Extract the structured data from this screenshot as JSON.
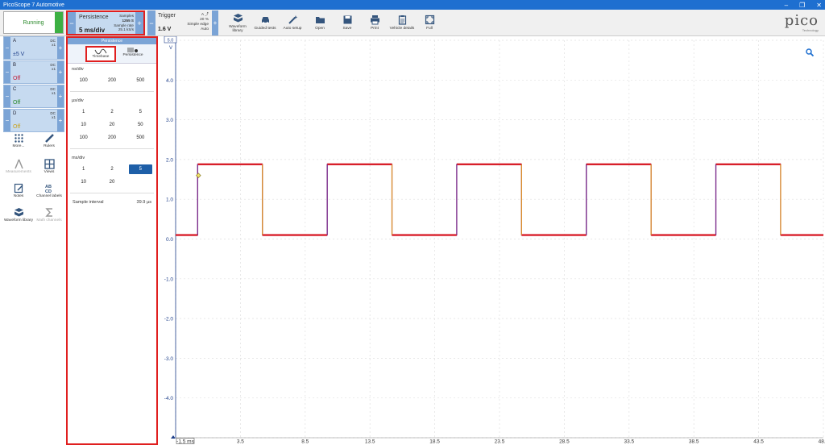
{
  "window": {
    "title": "PicoScope 7 Automotive",
    "controls": [
      "–",
      "❐",
      "✕"
    ]
  },
  "toolbar": {
    "run_label": "Running",
    "persistence": {
      "label": "Persistence",
      "timebase": "5 ms/div",
      "samples_label": "Samples",
      "samples": "1255 S",
      "sample_rate_label": "Sample rate",
      "sample_rate": "25.1 kS/s"
    },
    "trigger": {
      "label": "Trigger",
      "level": "1.6 V",
      "pct": "20 %",
      "mode": "Simple edge",
      "type": "Auto"
    },
    "tools": [
      {
        "label": "Waveform library",
        "icon": "library-icon"
      },
      {
        "label": "Guided tests",
        "icon": "car-icon"
      },
      {
        "label": "Auto setup",
        "icon": "wand-icon"
      },
      {
        "label": "Open",
        "icon": "folder-icon"
      },
      {
        "label": "Save",
        "icon": "save-icon"
      },
      {
        "label": "Print",
        "icon": "print-icon"
      },
      {
        "label": "Vehicle details",
        "icon": "clipboard-icon"
      },
      {
        "label": "Full",
        "icon": "fullscreen-icon"
      }
    ],
    "logo": "pico",
    "logo_sub": "Technology"
  },
  "channels": [
    {
      "name": "A",
      "coupling": "DC",
      "probe": "x1",
      "range": "±5 V",
      "color": "#1e3f8a"
    },
    {
      "name": "B",
      "coupling": "DC",
      "probe": "x1",
      "range": "Off",
      "color": "#c0203a"
    },
    {
      "name": "C",
      "coupling": "DC",
      "probe": "x1",
      "range": "Off",
      "color": "#2a8a2a"
    },
    {
      "name": "D",
      "coupling": "DC",
      "probe": "x1",
      "range": "Off",
      "color": "#c9a21a"
    }
  ],
  "left_panel": [
    {
      "label": "More...",
      "icon": "dots-grid-icon",
      "disabled": false
    },
    {
      "label": "Rulers",
      "icon": "ruler-icon",
      "disabled": false
    },
    {
      "label": "Measurements",
      "icon": "measure-icon",
      "disabled": true
    },
    {
      "label": "Views",
      "icon": "views-icon",
      "disabled": false
    },
    {
      "label": "Notes",
      "icon": "notes-icon",
      "disabled": false
    },
    {
      "label": "Channel labels",
      "icon": "abcd-icon",
      "disabled": false
    },
    {
      "label": "Waveform library",
      "icon": "library-icon",
      "disabled": false
    },
    {
      "label": "Math channels",
      "icon": "sigma-icon",
      "disabled": true
    }
  ],
  "timebase_panel": {
    "header": "Persistence",
    "tabs": [
      "Timebase",
      "Persistence"
    ],
    "sections": [
      {
        "label": "ns/div",
        "values": [
          "100",
          "200",
          "500"
        ]
      },
      {
        "label": "µs/div",
        "values": [
          "1",
          "2",
          "5",
          "10",
          "20",
          "50",
          "100",
          "200",
          "500"
        ]
      },
      {
        "label": "ms/div",
        "values": [
          "1",
          "2",
          "5",
          "10",
          "20"
        ]
      }
    ],
    "selected": "5",
    "sample_interval_label": "Sample interval",
    "sample_interval": "39.9 µs"
  },
  "scope": {
    "y_unit": "V",
    "y_range_label": "5.0",
    "x_unit": "ms",
    "y_ticks": [
      4.0,
      3.0,
      2.0,
      1.0,
      0.0,
      -1.0,
      -2.0,
      -3.0,
      -4.0
    ],
    "x_ticks": [
      -1.5,
      3.5,
      8.5,
      13.5,
      18.5,
      23.5,
      28.5,
      33.5,
      38.5,
      43.5,
      48.5
    ],
    "x_min": -1.5,
    "x_max": 48.5,
    "y_min": -5.0,
    "y_max": 5.0,
    "signal": {
      "low": 0.1,
      "high": 1.88,
      "period_ms": 10,
      "first_rise_ms": 0.2,
      "duty": 0.5,
      "colors": [
        "#d81f2a",
        "#e09020",
        "#7a2a8a"
      ]
    },
    "trigger_marker": {
      "x": 0.2,
      "y": 1.6
    },
    "grid": true
  }
}
